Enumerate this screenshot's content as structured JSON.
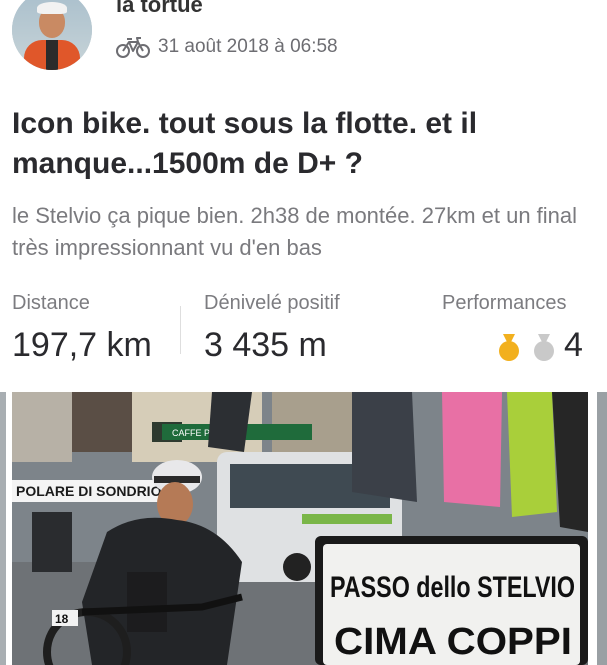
{
  "post": {
    "author": "la tortue",
    "activity_icon": "bike-icon",
    "date": "31 août 2018 à 06:58",
    "title": "Icon bike. tout sous la flotte. et il manque...1500m de D+ ?",
    "description": "le Stelvio ça pique bien. 2h38 de montée. 27km et un final très impressionnant vu d'en bas"
  },
  "stats": {
    "distance_label": "Distance",
    "distance_value": "197,7 km",
    "elevation_label": "Dénivelé positif",
    "elevation_value": "3 435 m",
    "performances_label": "Performances",
    "performances_value": "4",
    "medal_icons": [
      "gold-medal-icon",
      "silver-medal-icon"
    ]
  },
  "photo": {
    "sign_line1": "PASSO dello STELVIO",
    "sign_line2": "CIMA COPPI",
    "banner": "POLARE DI SONDRIO",
    "shop_sign": "CAFFE PERE",
    "bib": "18"
  },
  "colors": {
    "gold": "#f2b01e",
    "silver": "#c9c9c9",
    "text_primary": "#2a2a2e",
    "text_secondary": "#7a7a7e"
  }
}
